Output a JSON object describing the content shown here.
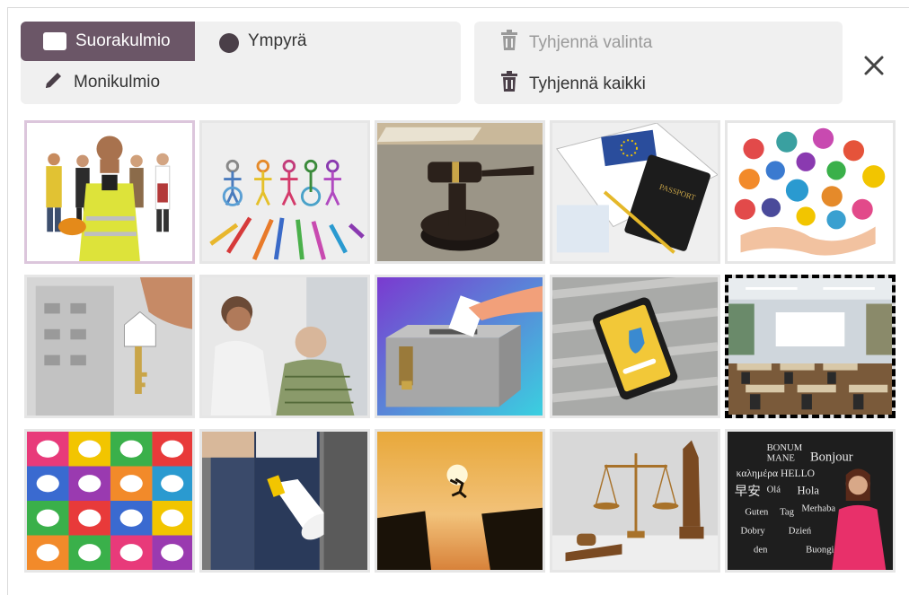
{
  "toolbar": {
    "rectangle_label": "Suorakulmio",
    "circle_label": "Ympyrä",
    "polygon_label": "Monikulmio",
    "clear_selection_label": "Tyhjennä valinta",
    "clear_all_label": "Tyhjennä kaikki"
  },
  "colors": {
    "active_tool": "#6b5667",
    "toolbar_bg": "#f0f0f0"
  },
  "images": [
    {
      "name": "workers",
      "state": "selected"
    },
    {
      "name": "children-drawing",
      "state": "normal"
    },
    {
      "name": "judge-gavel",
      "state": "normal"
    },
    {
      "name": "passport",
      "state": "normal"
    },
    {
      "name": "religion-symbols",
      "state": "normal"
    },
    {
      "name": "house-key",
      "state": "normal"
    },
    {
      "name": "caregiver-elderly",
      "state": "normal"
    },
    {
      "name": "ballot-box",
      "state": "normal"
    },
    {
      "name": "phone-security",
      "state": "normal"
    },
    {
      "name": "classroom",
      "state": "marked"
    },
    {
      "name": "speech-bubbles",
      "state": "normal"
    },
    {
      "name": "protest-megaphone",
      "state": "normal"
    },
    {
      "name": "leap-sunset",
      "state": "normal"
    },
    {
      "name": "justice-scales",
      "state": "normal"
    },
    {
      "name": "languages-blackboard",
      "state": "normal"
    }
  ]
}
